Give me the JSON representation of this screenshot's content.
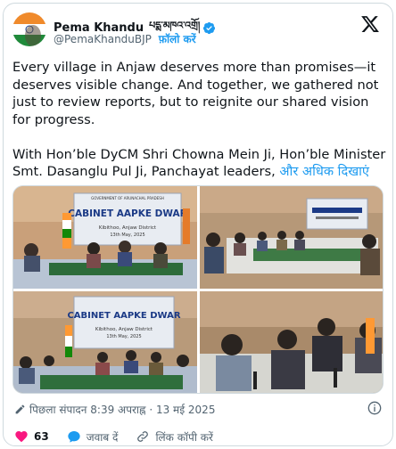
{
  "author": {
    "name": "Pema Khandu",
    "name_script": "པདྨ་མཁའ་འགྲོ།",
    "handle": "@PemaKhanduBJP",
    "follow_label": "फ़ॉलो करें",
    "verified": true
  },
  "post": {
    "paragraph1": "Every village in Anjaw deserves more than promises—it deserves visible change. And together, we gathered not just to review reports, but to reignite our shared vision for progress.",
    "paragraph2": "With Hon’ble DyCM Shri Chowna Mein Ji, Hon’ble Minister Smt. Dasanglu Pul Ji, Panchayat leaders,",
    "show_more": "और अधिक दिखाएं"
  },
  "photos": {
    "banner_title": "CABINET AAPKE DWAR",
    "banner_govt": "GOVERNMENT OF ARUNACHAL PRADESH",
    "banner_place": "Kibithoo, Anjaw District",
    "banner_date": "13th May, 2025"
  },
  "meta": {
    "edited_label": "पिछला संपादन 8:39 अपराह्न · 13 मई 2025"
  },
  "actions": {
    "like_count": "63",
    "reply_label": "जवाब दें",
    "copy_link_label": "लिंक कॉपी करें"
  },
  "colors": {
    "accent": "#1d9bf0",
    "like": "#f91880",
    "muted": "#536471"
  },
  "icons": [
    "verified-badge-icon",
    "x-logo-icon",
    "pencil-icon",
    "info-icon",
    "heart-icon",
    "reply-icon",
    "link-icon"
  ]
}
